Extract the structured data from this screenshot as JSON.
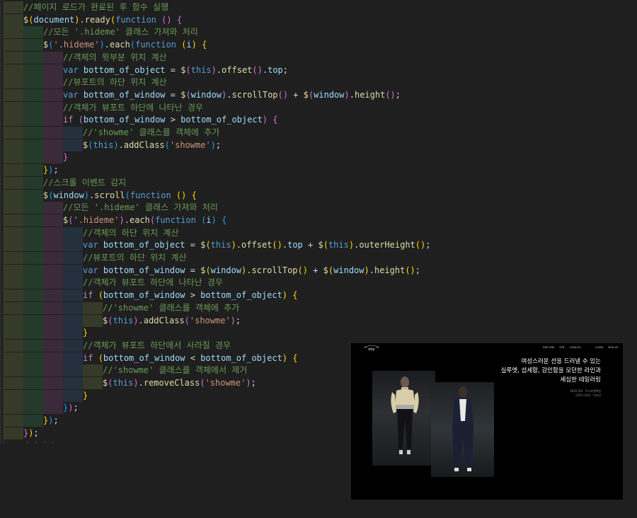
{
  "editor": {
    "lines": [
      {
        "indent": 2,
        "tokens": [
          [
            "c-comment",
            "//페이지 로드가 완료된 후 함수 실행"
          ]
        ]
      },
      {
        "indent": 2,
        "tokens": [
          [
            "c-fn",
            "$"
          ],
          [
            "c-p1",
            "("
          ],
          [
            "c-var",
            "document"
          ],
          [
            "c-p1",
            ")"
          ],
          [
            "c-plain",
            "."
          ],
          [
            "c-fn",
            "ready"
          ],
          [
            "c-p1",
            "("
          ],
          [
            "c-kw",
            "function"
          ],
          [
            "c-plain",
            " "
          ],
          [
            "c-p2",
            "()"
          ],
          [
            "c-plain",
            " "
          ],
          [
            "c-p2",
            "{"
          ]
        ]
      },
      {
        "indent": 3,
        "tokens": [
          [
            "c-comment",
            "//모든 '.hideme' 클래스 가져와 처리"
          ]
        ]
      },
      {
        "indent": 3,
        "tokens": [
          [
            "c-fn",
            "$"
          ],
          [
            "c-p3",
            "("
          ],
          [
            "c-str",
            "'.hideme'"
          ],
          [
            "c-p3",
            ")"
          ],
          [
            "c-plain",
            "."
          ],
          [
            "c-fn",
            "each"
          ],
          [
            "c-p3",
            "("
          ],
          [
            "c-kw",
            "function"
          ],
          [
            "c-plain",
            " "
          ],
          [
            "c-p1",
            "("
          ],
          [
            "c-var",
            "i"
          ],
          [
            "c-p1",
            ")"
          ],
          [
            "c-plain",
            " "
          ],
          [
            "c-p1",
            "{"
          ]
        ]
      },
      {
        "indent": 4,
        "tokens": [
          [
            "c-comment",
            "//객체의 윗부분 위치 계산"
          ]
        ]
      },
      {
        "indent": 4,
        "tokens": [
          [
            "c-kw",
            "var"
          ],
          [
            "c-plain",
            " "
          ],
          [
            "c-var",
            "bottom_of_object"
          ],
          [
            "c-plain",
            " = "
          ],
          [
            "c-fn",
            "$"
          ],
          [
            "c-p2",
            "("
          ],
          [
            "c-kw",
            "this"
          ],
          [
            "c-p2",
            ")"
          ],
          [
            "c-plain",
            "."
          ],
          [
            "c-fn",
            "offset"
          ],
          [
            "c-p2",
            "()"
          ],
          [
            "c-plain",
            "."
          ],
          [
            "c-var",
            "top"
          ],
          [
            "c-plain",
            ";"
          ]
        ]
      },
      {
        "indent": 4,
        "tokens": [
          [
            "c-comment",
            "//뷰포트의 하단 위치 계산"
          ]
        ]
      },
      {
        "indent": 4,
        "tokens": [
          [
            "c-kw",
            "var"
          ],
          [
            "c-plain",
            " "
          ],
          [
            "c-var",
            "bottom_of_window"
          ],
          [
            "c-plain",
            " = "
          ],
          [
            "c-fn",
            "$"
          ],
          [
            "c-p2",
            "("
          ],
          [
            "c-var",
            "window"
          ],
          [
            "c-p2",
            ")"
          ],
          [
            "c-plain",
            "."
          ],
          [
            "c-fn",
            "scrollTop"
          ],
          [
            "c-p2",
            "()"
          ],
          [
            "c-plain",
            " + "
          ],
          [
            "c-fn",
            "$"
          ],
          [
            "c-p2",
            "("
          ],
          [
            "c-var",
            "window"
          ],
          [
            "c-p2",
            ")"
          ],
          [
            "c-plain",
            "."
          ],
          [
            "c-fn",
            "height"
          ],
          [
            "c-p2",
            "()"
          ],
          [
            "c-plain",
            ";"
          ]
        ]
      },
      {
        "indent": 4,
        "tokens": [
          [
            "c-comment",
            "//객체가 뷰포트 하단에 나타난 경우"
          ]
        ]
      },
      {
        "indent": 4,
        "tokens": [
          [
            "c-ctrl",
            "if"
          ],
          [
            "c-plain",
            " "
          ],
          [
            "c-p2",
            "("
          ],
          [
            "c-var",
            "bottom_of_window"
          ],
          [
            "c-plain",
            " > "
          ],
          [
            "c-var",
            "bottom_of_object"
          ],
          [
            "c-p2",
            ")"
          ],
          [
            "c-plain",
            " "
          ],
          [
            "c-p2",
            "{"
          ]
        ]
      },
      {
        "indent": 5,
        "tokens": [
          [
            "c-comment",
            "//'showme' 클래스를 객체에 추가"
          ]
        ]
      },
      {
        "indent": 5,
        "tokens": [
          [
            "c-fn",
            "$"
          ],
          [
            "c-p3",
            "("
          ],
          [
            "c-kw",
            "this"
          ],
          [
            "c-p3",
            ")"
          ],
          [
            "c-plain",
            "."
          ],
          [
            "c-fn",
            "addClass"
          ],
          [
            "c-p3",
            "("
          ],
          [
            "c-str",
            "'showme'"
          ],
          [
            "c-p3",
            ")"
          ],
          [
            "c-plain",
            ";"
          ]
        ]
      },
      {
        "indent": 4,
        "tokens": [
          [
            "c-p2",
            "}"
          ]
        ]
      },
      {
        "indent": 3,
        "tokens": [
          [
            "c-p1",
            "}"
          ],
          [
            "c-p3",
            ")"
          ],
          [
            "c-plain",
            ";"
          ]
        ]
      },
      {
        "indent": 3,
        "tokens": [
          [
            "c-comment",
            "//스크롤 이벤트 감지"
          ]
        ]
      },
      {
        "indent": 3,
        "tokens": [
          [
            "c-fn",
            "$"
          ],
          [
            "c-p3",
            "("
          ],
          [
            "c-var",
            "window"
          ],
          [
            "c-p3",
            ")"
          ],
          [
            "c-plain",
            "."
          ],
          [
            "c-fn",
            "scroll"
          ],
          [
            "c-p3",
            "("
          ],
          [
            "c-kw",
            "function"
          ],
          [
            "c-plain",
            " "
          ],
          [
            "c-p1",
            "()"
          ],
          [
            "c-plain",
            " "
          ],
          [
            "c-p1",
            "{"
          ]
        ]
      },
      {
        "indent": 4,
        "tokens": [
          [
            "c-comment",
            "//모든 '.hideme' 클래스 가져와 처리"
          ]
        ]
      },
      {
        "indent": 4,
        "tokens": [
          [
            "c-fn",
            "$"
          ],
          [
            "c-p2",
            "("
          ],
          [
            "c-str",
            "'.hideme'"
          ],
          [
            "c-p2",
            ")"
          ],
          [
            "c-plain",
            "."
          ],
          [
            "c-fn",
            "each"
          ],
          [
            "c-p2",
            "("
          ],
          [
            "c-kw",
            "function"
          ],
          [
            "c-plain",
            " "
          ],
          [
            "c-p3",
            "("
          ],
          [
            "c-var",
            "i"
          ],
          [
            "c-p3",
            ")"
          ],
          [
            "c-plain",
            " "
          ],
          [
            "c-p3",
            "{"
          ]
        ]
      },
      {
        "indent": 5,
        "tokens": [
          [
            "c-comment",
            "//객체의 하단 위치 계산"
          ]
        ]
      },
      {
        "indent": 5,
        "tokens": [
          [
            "c-kw",
            "var"
          ],
          [
            "c-plain",
            " "
          ],
          [
            "c-var",
            "bottom_of_object"
          ],
          [
            "c-plain",
            " = "
          ],
          [
            "c-fn",
            "$"
          ],
          [
            "c-p1",
            "("
          ],
          [
            "c-kw",
            "this"
          ],
          [
            "c-p1",
            ")"
          ],
          [
            "c-plain",
            "."
          ],
          [
            "c-fn",
            "offset"
          ],
          [
            "c-p1",
            "()"
          ],
          [
            "c-plain",
            "."
          ],
          [
            "c-var",
            "top"
          ],
          [
            "c-plain",
            " + "
          ],
          [
            "c-fn",
            "$"
          ],
          [
            "c-p1",
            "("
          ],
          [
            "c-kw",
            "this"
          ],
          [
            "c-p1",
            ")"
          ],
          [
            "c-plain",
            "."
          ],
          [
            "c-fn",
            "outerHeight"
          ],
          [
            "c-p1",
            "()"
          ],
          [
            "c-plain",
            ";"
          ]
        ]
      },
      {
        "indent": 5,
        "tokens": [
          [
            "c-comment",
            "//뷰포트의 하단 위치 계산"
          ]
        ]
      },
      {
        "indent": 5,
        "tokens": [
          [
            "c-kw",
            "var"
          ],
          [
            "c-plain",
            " "
          ],
          [
            "c-var",
            "bottom_of_window"
          ],
          [
            "c-plain",
            " = "
          ],
          [
            "c-fn",
            "$"
          ],
          [
            "c-p1",
            "("
          ],
          [
            "c-var",
            "window"
          ],
          [
            "c-p1",
            ")"
          ],
          [
            "c-plain",
            "."
          ],
          [
            "c-fn",
            "scrollTop"
          ],
          [
            "c-p1",
            "()"
          ],
          [
            "c-plain",
            " + "
          ],
          [
            "c-fn",
            "$"
          ],
          [
            "c-p1",
            "("
          ],
          [
            "c-var",
            "window"
          ],
          [
            "c-p1",
            ")"
          ],
          [
            "c-plain",
            "."
          ],
          [
            "c-fn",
            "height"
          ],
          [
            "c-p1",
            "()"
          ],
          [
            "c-plain",
            ";"
          ]
        ]
      },
      {
        "indent": 5,
        "tokens": [
          [
            "c-comment",
            "//객체가 뷰포트 하단에 나타난 경우"
          ]
        ]
      },
      {
        "indent": 5,
        "tokens": [
          [
            "c-ctrl",
            "if"
          ],
          [
            "c-plain",
            " "
          ],
          [
            "c-p1",
            "("
          ],
          [
            "c-var",
            "bottom_of_window"
          ],
          [
            "c-plain",
            " > "
          ],
          [
            "c-var",
            "bottom_of_object"
          ],
          [
            "c-p1",
            ")"
          ],
          [
            "c-plain",
            " "
          ],
          [
            "c-p1",
            "{"
          ]
        ]
      },
      {
        "indent": 6,
        "tokens": [
          [
            "c-comment",
            "//'showme' 클래스를 객체에 추가"
          ]
        ]
      },
      {
        "indent": 6,
        "tokens": [
          [
            "c-fn",
            "$"
          ],
          [
            "c-p2",
            "("
          ],
          [
            "c-kw",
            "this"
          ],
          [
            "c-p2",
            ")"
          ],
          [
            "c-plain",
            "."
          ],
          [
            "c-fn",
            "addClass"
          ],
          [
            "c-p2",
            "("
          ],
          [
            "c-str",
            "'showme'"
          ],
          [
            "c-p2",
            ")"
          ],
          [
            "c-plain",
            ";"
          ]
        ]
      },
      {
        "indent": 5,
        "tokens": [
          [
            "c-p1",
            "}"
          ]
        ]
      },
      {
        "indent": 5,
        "tokens": [
          [
            "c-comment",
            "//객체가 뷰포트 하단에서 사라질 경우"
          ]
        ]
      },
      {
        "indent": 5,
        "tokens": [
          [
            "c-ctrl",
            "if"
          ],
          [
            "c-plain",
            " "
          ],
          [
            "c-p1",
            "("
          ],
          [
            "c-var",
            "bottom_of_window"
          ],
          [
            "c-plain",
            " < "
          ],
          [
            "c-var",
            "bottom_of_object"
          ],
          [
            "c-p1",
            ")"
          ],
          [
            "c-plain",
            " "
          ],
          [
            "c-p1",
            "{"
          ]
        ]
      },
      {
        "indent": 6,
        "tokens": [
          [
            "c-comment",
            "//'showme' 클래스를 객체에서 제거"
          ]
        ]
      },
      {
        "indent": 6,
        "tokens": [
          [
            "c-fn",
            "$"
          ],
          [
            "c-p2",
            "("
          ],
          [
            "c-kw",
            "this"
          ],
          [
            "c-p2",
            ")"
          ],
          [
            "c-plain",
            "."
          ],
          [
            "c-fn",
            "removeClass"
          ],
          [
            "c-p2",
            "("
          ],
          [
            "c-str",
            "'showme'"
          ],
          [
            "c-p2",
            ")"
          ],
          [
            "c-plain",
            ";"
          ]
        ]
      },
      {
        "indent": 5,
        "tokens": [
          [
            "c-p1",
            "}"
          ]
        ]
      },
      {
        "indent": 4,
        "tokens": [
          [
            "c-p3",
            "}"
          ],
          [
            "c-p2",
            ")"
          ],
          [
            "c-plain",
            ";"
          ]
        ]
      },
      {
        "indent": 3,
        "tokens": [
          [
            "c-p1",
            "}"
          ],
          [
            "c-p3",
            ")"
          ],
          [
            "c-plain",
            ";"
          ]
        ]
      },
      {
        "indent": 2,
        "tokens": [
          [
            "c-p2",
            "}"
          ],
          [
            "c-p1",
            ")"
          ],
          [
            "c-plain",
            ";"
          ]
        ]
      }
    ],
    "fold_marker": "· · · ·"
  },
  "preview": {
    "logo_text": "ddp",
    "nav_left": [
      "DDP ONE",
      "STN",
      "CATALOG"
    ],
    "nav_right": [
      "LOGIN",
      "SIGN UP"
    ],
    "headline": [
      "여성스러운 선을 드러낼 수 있는",
      "실루엣, 섬세함, 강인함을 모던한 라인과",
      "세심한 테일러링"
    ],
    "meta": [
      "2020 S/S · 트스츠컬렉션",
      "CEO 디자인 · 디자인"
    ],
    "colors": {
      "background": "#000000",
      "headline": "#ffffff",
      "meta": "#8d8d8d"
    }
  }
}
